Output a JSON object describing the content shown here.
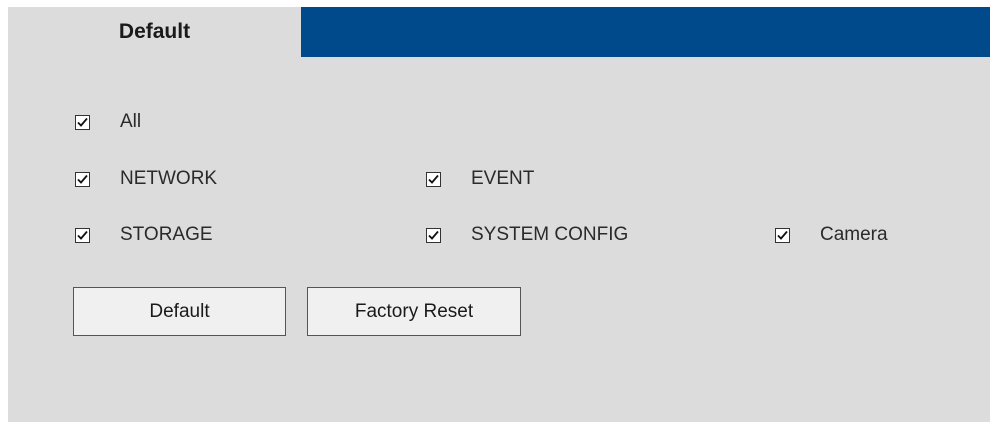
{
  "tabs": [
    {
      "label": "Default",
      "active": true
    }
  ],
  "tab_bar_color": "#004a8c",
  "checkboxes": [
    {
      "label": "All",
      "checked": true
    },
    {
      "label": "NETWORK",
      "checked": true
    },
    {
      "label": "EVENT",
      "checked": true
    },
    {
      "label": "STORAGE",
      "checked": true
    },
    {
      "label": "SYSTEM CONFIG",
      "checked": true
    },
    {
      "label": "Camera",
      "checked": true
    }
  ],
  "buttons": {
    "default_label": "Default",
    "factory_reset_label": "Factory Reset"
  }
}
